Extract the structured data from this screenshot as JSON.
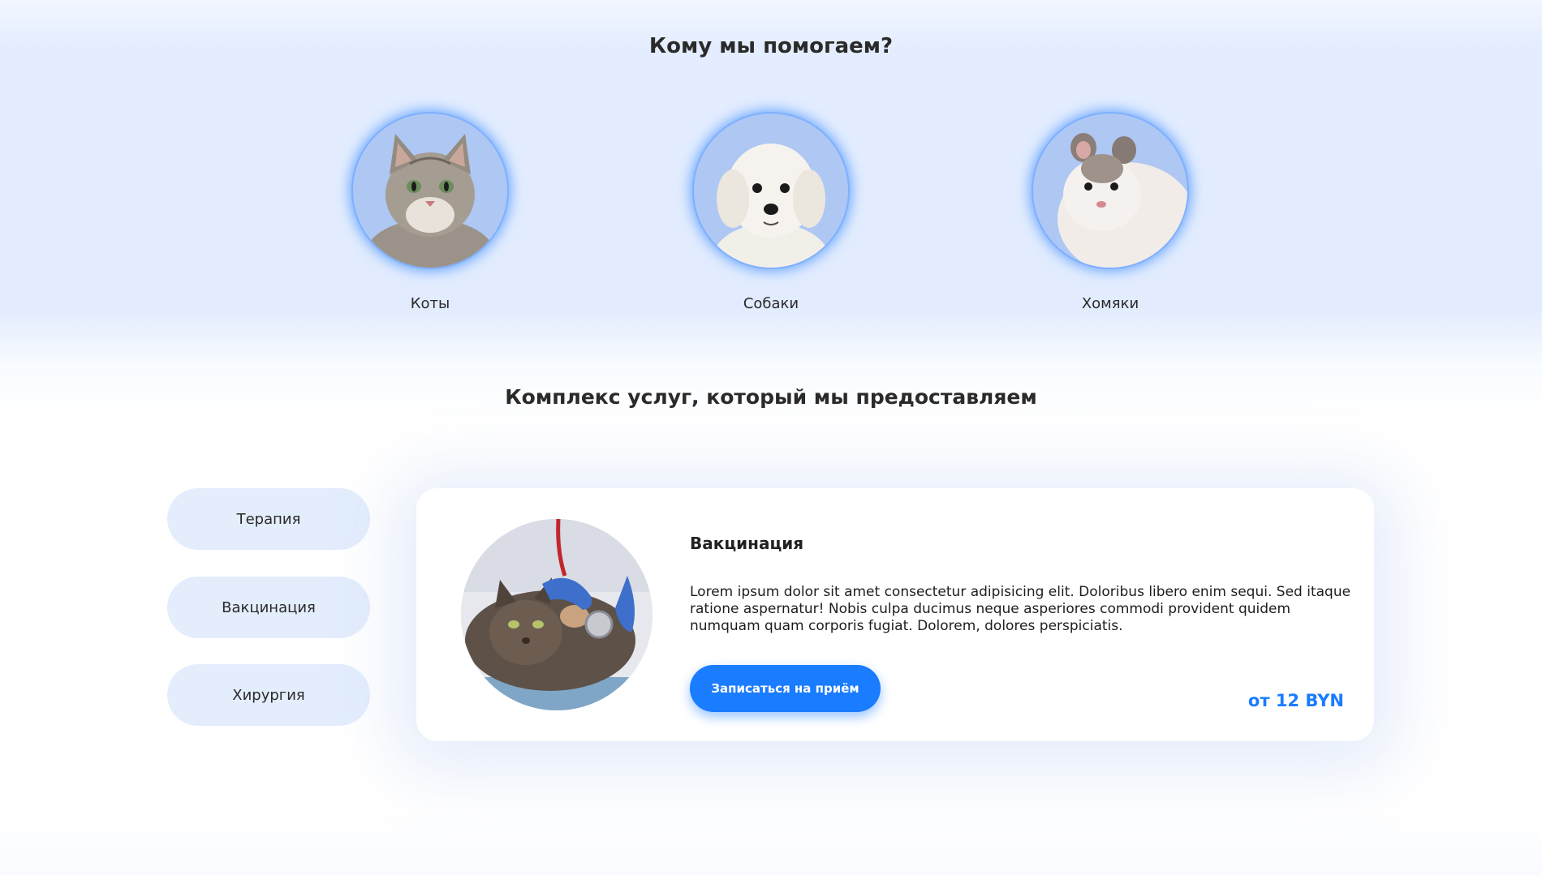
{
  "who_we_help": {
    "title": "Кому мы помогаем?",
    "animals": [
      {
        "label": "Коты",
        "icon": "cat-photo"
      },
      {
        "label": "Собаки",
        "icon": "dog-photo"
      },
      {
        "label": "Хомяки",
        "icon": "hamster-photo"
      }
    ]
  },
  "services": {
    "title": "Комплекс услуг, который мы предоставляем",
    "tabs": [
      "Терапия",
      "Вакцинация",
      "Хирургия"
    ],
    "active": {
      "title": "Вакцинация",
      "description": "Lorem ipsum dolor sit amet consectetur adipisicing elit. Doloribus libero enim sequi. Sed itaque ratione aspernatur! Nobis culpa ducimus neque asperiores commodi provident quidem numquam quam corporis fugiat. Dolorem, dolores perspiciatis.",
      "button_label": "Записаться на приём",
      "price": "от 12 BYN"
    }
  },
  "colors": {
    "accent": "#1a7cff",
    "tab_bg": "#e3edfc",
    "circle_bg": "#aec7f3"
  }
}
